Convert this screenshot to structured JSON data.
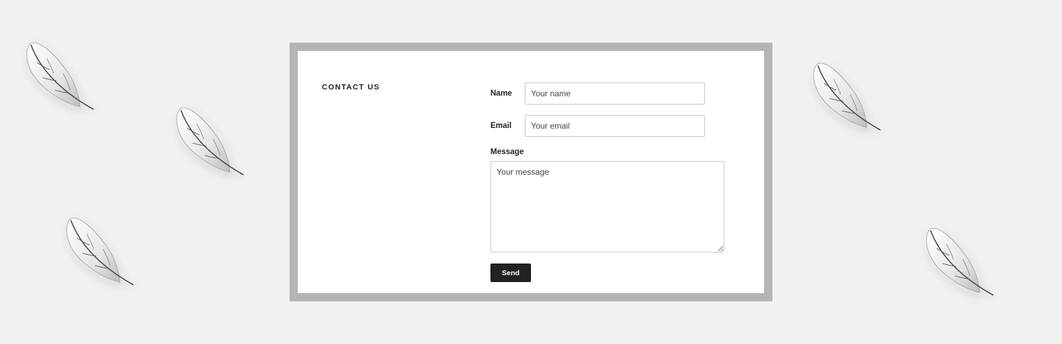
{
  "contact": {
    "heading": "CONTACT US",
    "name_label": "Name",
    "name_placeholder": "Your name",
    "email_label": "Email",
    "email_placeholder": "Your email",
    "message_label": "Message",
    "message_placeholder": "Your message",
    "send_label": "Send"
  },
  "decorations": {
    "icon": "feather-icon"
  },
  "colors": {
    "background": "#f1f1f1",
    "frame": "#b5b5b5",
    "card": "#ffffff",
    "button": "#222222"
  }
}
